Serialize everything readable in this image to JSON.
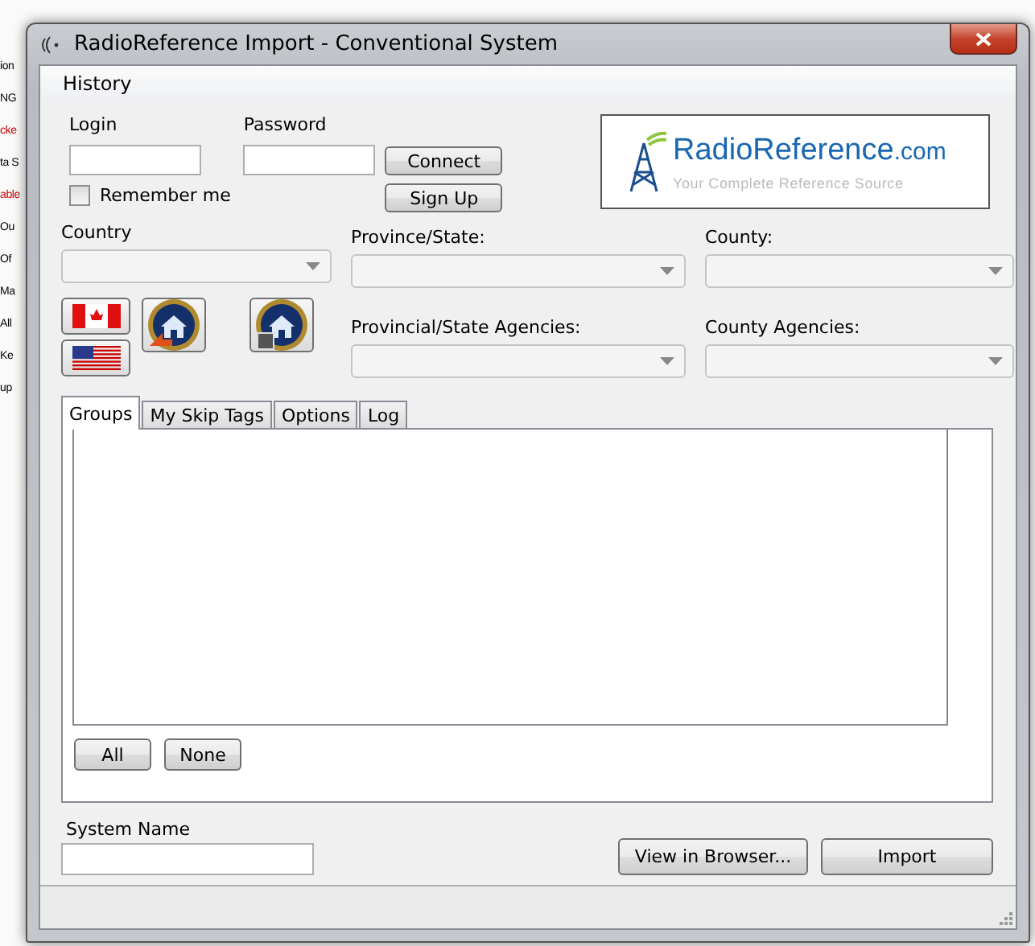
{
  "background_app": {
    "fragments": [
      {
        "text": "ion",
        "color": "#000000"
      },
      {
        "text": "NG",
        "color": "#000000"
      },
      {
        "text": "cke",
        "color": "#cc0000"
      },
      {
        "text": "ta S",
        "color": "#000000"
      },
      {
        "text": "able",
        "color": "#cc0000"
      },
      {
        "text": "Ou",
        "color": "#000000"
      },
      {
        "text": "Of",
        "color": "#000000"
      },
      {
        "text": "Ma",
        "color": "#000000"
      },
      {
        "text": "All",
        "color": "#000000"
      },
      {
        "text": "Ke",
        "color": "#000000"
      },
      {
        "text": "up",
        "color": "#000000"
      }
    ]
  },
  "window": {
    "title": "RadioReference Import - Conventional System"
  },
  "menu": [
    "History"
  ],
  "login": {
    "login_label": "Login",
    "password_label": "Password",
    "connect": "Connect",
    "sign_up": "Sign Up",
    "remember_me": {
      "label": "Remember me",
      "checked": false
    }
  },
  "logo": {
    "name": "RadioReference",
    "suffix": ".com",
    "tagline": "Your Complete Reference Source"
  },
  "selectors": {
    "country": "Country",
    "province": "Province/State:",
    "county": "County:",
    "provincial_agencies": "Provincial/State Agencies:",
    "county_agencies": "County Agencies:"
  },
  "tabs": [
    {
      "label": "Groups",
      "selected": true
    },
    {
      "label": "My Skip Tags",
      "selected": false
    },
    {
      "label": "Options",
      "selected": false
    },
    {
      "label": "Log",
      "selected": false
    }
  ],
  "groups_buttons": [
    "All",
    "None"
  ],
  "system_name": {
    "label": "System Name"
  },
  "buttons": [
    "View in Browser...",
    "Import"
  ]
}
